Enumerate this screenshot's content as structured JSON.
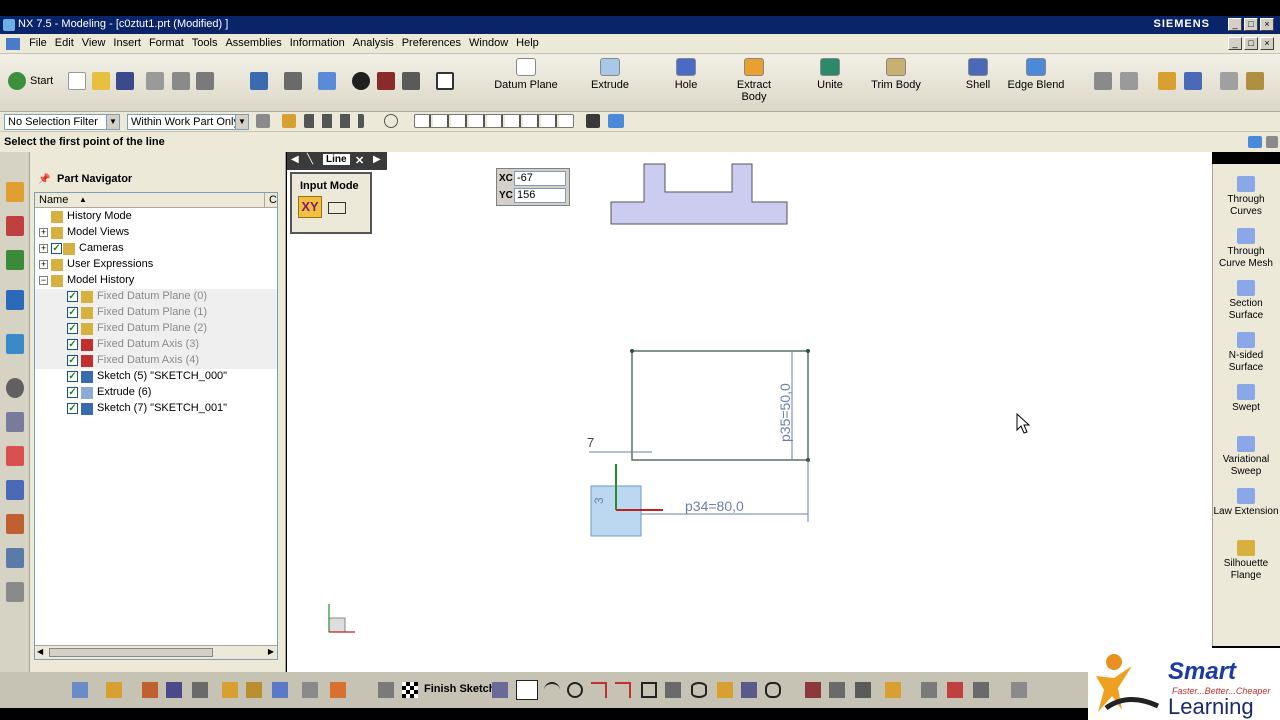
{
  "window": {
    "title": "NX 7.5 - Modeling - [c0ztut1.prt (Modified) ]",
    "brand": "SIEMENS"
  },
  "menu": [
    "File",
    "Edit",
    "View",
    "Insert",
    "Format",
    "Tools",
    "Assemblies",
    "Information",
    "Analysis",
    "Preferences",
    "Window",
    "Help"
  ],
  "toolbar": {
    "start_label": "Start",
    "buttons": [
      {
        "label": "Datum Plane"
      },
      {
        "label": "Extrude"
      },
      {
        "label": "Hole"
      },
      {
        "label": "Extract\nBody"
      },
      {
        "label": "Unite"
      },
      {
        "label": "Trim Body"
      },
      {
        "label": "Shell"
      },
      {
        "label": "Edge Blend"
      }
    ]
  },
  "selection_bar": {
    "filter": "No Selection Filter",
    "scope": "Within Work Part Only"
  },
  "status_prompt": "Select the first point of the line",
  "navigator": {
    "title": "Part Navigator",
    "col_name": "Name",
    "col_c": "C",
    "rows": [
      {
        "label": "History Mode",
        "indent": 0,
        "expand": "",
        "check": false,
        "dim": false
      },
      {
        "label": "Model Views",
        "indent": 0,
        "expand": "+",
        "check": false,
        "dim": false
      },
      {
        "label": "Cameras",
        "indent": 0,
        "expand": "+",
        "check": true,
        "dim": false
      },
      {
        "label": "User Expressions",
        "indent": 0,
        "expand": "+",
        "check": false,
        "dim": false
      },
      {
        "label": "Model History",
        "indent": 0,
        "expand": "-",
        "check": false,
        "dim": false
      },
      {
        "label": "Fixed Datum Plane (0)",
        "indent": 1,
        "expand": "",
        "check": true,
        "dim": true
      },
      {
        "label": "Fixed Datum Plane (1)",
        "indent": 1,
        "expand": "",
        "check": true,
        "dim": true
      },
      {
        "label": "Fixed Datum Plane (2)",
        "indent": 1,
        "expand": "",
        "check": true,
        "dim": true
      },
      {
        "label": "Fixed Datum Axis (3)",
        "indent": 1,
        "expand": "",
        "check": true,
        "dim": true
      },
      {
        "label": "Fixed Datum Axis (4)",
        "indent": 1,
        "expand": "",
        "check": true,
        "dim": true
      },
      {
        "label": "Sketch (5) \"SKETCH_000\"",
        "indent": 1,
        "expand": "",
        "check": true,
        "dim": false
      },
      {
        "label": "Extrude (6)",
        "indent": 1,
        "expand": "",
        "check": true,
        "dim": false
      },
      {
        "label": "Sketch (7) \"SKETCH_001\"",
        "indent": 1,
        "expand": "",
        "check": true,
        "dim": false
      }
    ]
  },
  "line_dialog": {
    "title": "Line",
    "input_mode_label": "Input Mode",
    "xy_label": "XY"
  },
  "coords": {
    "xc_label": "XC",
    "xc_value": "-67",
    "yc_label": "YC",
    "yc_value": "156"
  },
  "sketch_dims": {
    "d7": "7",
    "d3": "3",
    "p35": "p35=50,0",
    "p34": "p34=80,0"
  },
  "surface_panel": [
    {
      "label": "Through Curves"
    },
    {
      "label": "Through Curve Mesh"
    },
    {
      "label": "Section Surface"
    },
    {
      "label": "N-sided Surface"
    },
    {
      "label": "Swept"
    },
    {
      "label": "Variational Sweep"
    },
    {
      "label": "Law Extension"
    },
    {
      "label": "Silhouette Flange"
    }
  ],
  "bottom": {
    "finish_sketch": "Finish Sketch"
  },
  "logo": {
    "name": "Smart",
    "tagline": "Faster...Better...Cheaper",
    "sub": "Learning"
  },
  "colors": {
    "title_bar": "#0a246a",
    "face": "#ccccf0",
    "sketch_line": "#2f4f3f",
    "dim_text": "#6b7fa8"
  }
}
